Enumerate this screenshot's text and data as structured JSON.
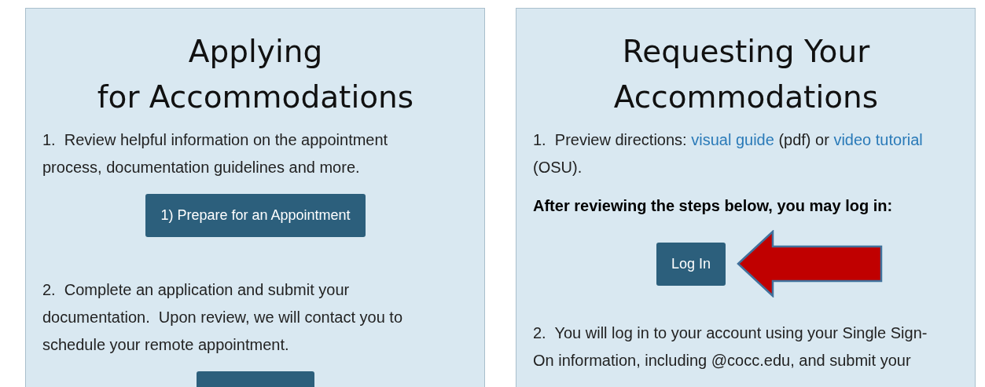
{
  "cards": [
    {
      "title_lines": [
        "Applying",
        "for Accommodations"
      ],
      "blocks": [
        {
          "kind": "paragraph",
          "text": "1.  Review helpful information on the appointment process, documentation guidelines and more."
        },
        {
          "kind": "button",
          "label": "1) Prepare for an Appointment"
        },
        {
          "kind": "paragraph",
          "text": "2.  Complete an application and submit your documentation.  Upon review, we will contact you to schedule your remote appointment."
        },
        {
          "kind": "button"
        }
      ]
    },
    {
      "title_lines": [
        "Requesting Your",
        "Accommodations"
      ],
      "blocks": [
        {
          "kind": "linked",
          "parts": [
            {
              "text": "1.  Preview directions: ",
              "link": false
            },
            {
              "text": "visual guide",
              "link": true
            },
            {
              "text": " (pdf) or ",
              "link": false
            },
            {
              "text": "video tutorial",
              "link": true
            },
            {
              "text": " (OSU).",
              "link": false
            }
          ]
        },
        {
          "kind": "note",
          "text": "After reviewing the steps below, you may log in:"
        },
        {
          "kind": "button_arrow",
          "label": "Log In"
        },
        {
          "kind": "paragraph",
          "text": "2.  You will log in to your account using your Single Sign-On information, including @cocc.edu, and submit your"
        }
      ]
    }
  ]
}
